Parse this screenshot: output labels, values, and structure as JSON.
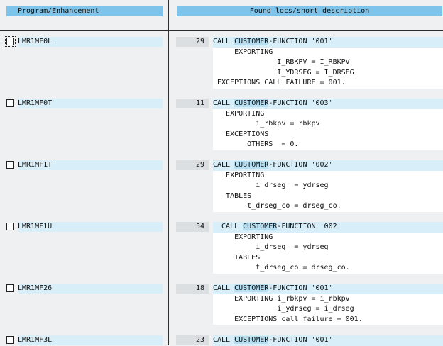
{
  "header": {
    "left_label": "Program/Enhancement",
    "right_label": "Found locs/short description"
  },
  "results": [
    {
      "program": "LMR1MF0L",
      "count": "29",
      "code": {
        "first_pre": "CALL ",
        "first_hl": "CUSTOMER",
        "first_post": "-FUNCTION '001'",
        "rest": [
          "     EXPORTING",
          "               I_RBKPV = I_RBKPV",
          "               I_YDRSEG = I_DRSEG",
          " EXCEPTIONS CALL_FAILURE = 001."
        ]
      }
    },
    {
      "program": "LMR1MF0T",
      "count": "11",
      "code": {
        "first_pre": "CALL ",
        "first_hl": "CUSTOMER",
        "first_post": "-FUNCTION '003'",
        "rest": [
          "   EXPORTING",
          "          i_rbkpv = rbkpv",
          "   EXCEPTIONS",
          "        OTHERS  = 0."
        ]
      }
    },
    {
      "program": "LMR1MF1T",
      "count": "29",
      "code": {
        "first_pre": "CALL ",
        "first_hl": "CUSTOMER",
        "first_post": "-FUNCTION '002'",
        "rest": [
          "   EXPORTING",
          "          i_drseg  = ydrseg",
          "   TABLES",
          "        t_drseg_co = drseg_co."
        ]
      }
    },
    {
      "program": "LMR1MF1U",
      "count": "54",
      "code": {
        "first_pre": "  CALL ",
        "first_hl": "CUSTOMER",
        "first_post": "-FUNCTION '002'",
        "rest": [
          "     EXPORTING",
          "          i_drseg  = ydrseg",
          "     TABLES",
          "          t_drseg_co = drseg_co."
        ]
      }
    },
    {
      "program": "LMR1MF26",
      "count": "18",
      "code": {
        "first_pre": "CALL ",
        "first_hl": "CUSTOMER",
        "first_post": "-FUNCTION '001'",
        "rest": [
          "     EXPORTING i_rbkpv = i_rbkpv",
          "               i_ydrseg = i_drseg",
          "     EXCEPTIONS call_failure = 001."
        ]
      }
    },
    {
      "program": "LMR1MF3L",
      "count": "23",
      "code": {
        "first_pre": "CALL ",
        "first_hl": "CUSTOMER",
        "first_post": "-FUNCTION '001'",
        "rest": []
      }
    }
  ]
}
